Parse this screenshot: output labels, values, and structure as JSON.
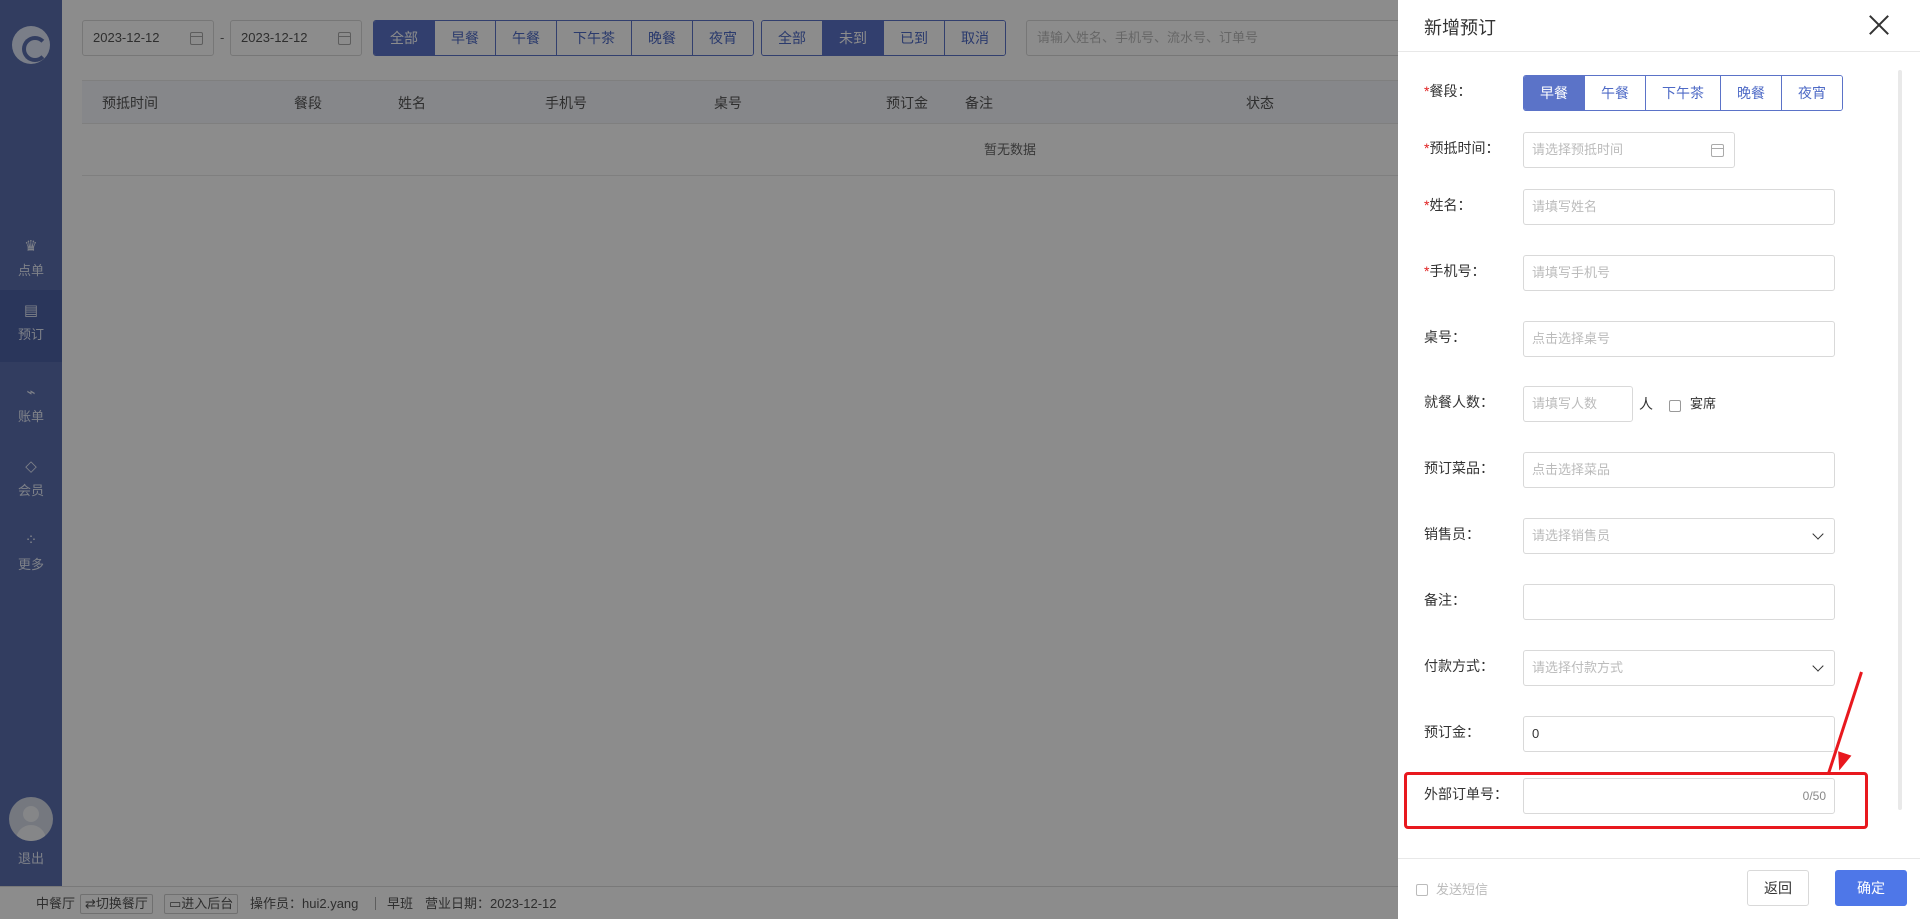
{
  "sidebar": {
    "items": [
      {
        "label": "点单",
        "icon": "chef-hat-icon"
      },
      {
        "label": "预订",
        "icon": "book-icon"
      },
      {
        "label": "账单",
        "icon": "chart-icon"
      },
      {
        "label": "会员",
        "icon": "diamond-icon"
      },
      {
        "label": "更多",
        "icon": "grid-icon"
      }
    ],
    "logout_label": "退出"
  },
  "filters": {
    "date_start": "2023-12-12",
    "date_end": "2023-12-12",
    "date_sep": "-",
    "meal_segments": [
      "全部",
      "早餐",
      "午餐",
      "下午茶",
      "晚餐",
      "夜宵"
    ],
    "meal_selected": "全部",
    "status_segments": [
      "全部",
      "未到",
      "已到",
      "取消"
    ],
    "status_selected": "未到",
    "search_placeholder": "请输入姓名、手机号、流水号、订单号"
  },
  "table": {
    "columns": [
      "预抵时间",
      "餐段",
      "姓名",
      "手机号",
      "桌号",
      "预订金",
      "备注",
      "状态"
    ],
    "empty_text": "暂无数据"
  },
  "statusbar": {
    "hall": "中餐厅",
    "switch_label": "⇄切换餐厅",
    "backend_label": "进入后台",
    "operator": "操作员：hui2.yang",
    "shift": "早班",
    "business_date": "营业日期：2023-12-12"
  },
  "drawer": {
    "title": "新增预订",
    "fields": {
      "meal": {
        "label": "餐段：",
        "required": "*",
        "segments": [
          "早餐",
          "午餐",
          "下午茶",
          "晚餐",
          "夜宵"
        ],
        "selected": "早餐"
      },
      "arrival_time": {
        "label": "预抵时间：",
        "required": "*",
        "placeholder": "请选择预抵时间"
      },
      "name": {
        "label": "姓名：",
        "required": "*",
        "placeholder": "请填写姓名"
      },
      "phone": {
        "label": "手机号：",
        "required": "*",
        "placeholder": "请填写手机号"
      },
      "table_no": {
        "label": "桌号：",
        "placeholder": "点击选择桌号"
      },
      "guests": {
        "label": "就餐人数：",
        "placeholder": "请填写人数",
        "unit": "人",
        "banquet_label": "宴席"
      },
      "dishes": {
        "label": "预订菜品：",
        "placeholder": "点击选择菜品"
      },
      "salesperson": {
        "label": "销售员：",
        "placeholder": "请选择销售员"
      },
      "remark": {
        "label": "备注：",
        "value": ""
      },
      "payment": {
        "label": "付款方式：",
        "placeholder": "请选择付款方式"
      },
      "deposit": {
        "label": "预订金：",
        "value": "0"
      },
      "external_order": {
        "label": "外部订单号：",
        "value": "",
        "counter": "0/50"
      }
    },
    "footer": {
      "sms_label": "发送短信",
      "back_label": "返回",
      "confirm_label": "确定"
    }
  },
  "colors": {
    "sidebar": "#5b6fb0",
    "primary": "#5b73c8",
    "confirm": "#4e77e8",
    "highlight": "#e8181e"
  }
}
